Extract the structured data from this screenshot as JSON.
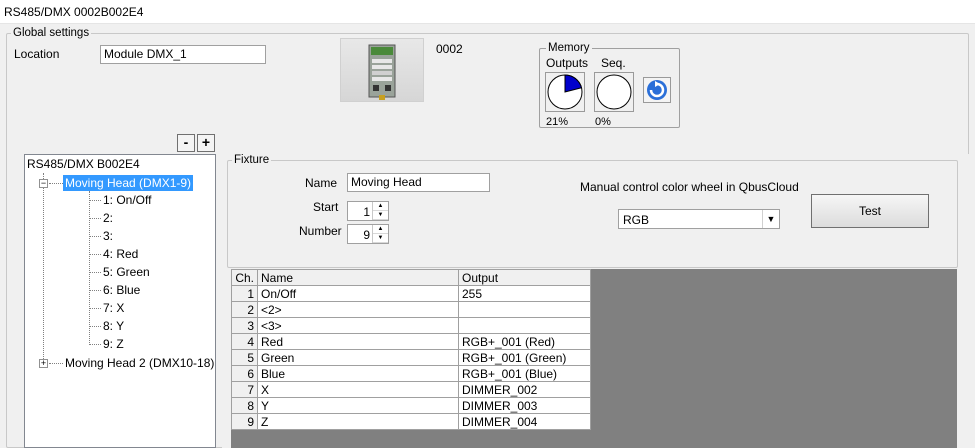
{
  "window": {
    "title": "RS485/DMX 0002B002E4"
  },
  "global_settings": {
    "label": "Global settings",
    "location_label": "Location",
    "location_value": "Module DMX_1",
    "device_id": "0002"
  },
  "memory": {
    "label": "Memory",
    "outputs_label": "Outputs",
    "seq_label": "Seq.",
    "outputs_pct": "21%",
    "seq_pct": "0%",
    "outputs_fraction": 0.21,
    "seq_fraction": 0.0,
    "pie_fill_color": "#0000cc"
  },
  "tree_buttons": {
    "collapse": "-",
    "expand": "+"
  },
  "tree": {
    "root": "RS485/DMX B002E4",
    "node1": {
      "label": "Moving Head (DMX1-9)",
      "children": [
        "1: On/Off",
        "2:",
        "3:",
        "4: Red",
        "5: Green",
        "6: Blue",
        "7: X",
        "8: Y",
        "9: Z"
      ]
    },
    "node2": {
      "label": "Moving Head 2 (DMX10-18)"
    }
  },
  "fixture": {
    "label": "Fixture",
    "name_label": "Name",
    "name_value": "Moving Head",
    "start_label": "Start",
    "start_value": "1",
    "number_label": "Number",
    "number_value": "9",
    "color_wheel_label": "Manual control color wheel in QbusCloud",
    "color_wheel_value": "RGB",
    "test_button": "Test"
  },
  "grid": {
    "headers": [
      "Ch.",
      "Name",
      "Output"
    ],
    "rows": [
      {
        "ch": "1",
        "name": "On/Off",
        "output": "255"
      },
      {
        "ch": "2",
        "name": "<2>",
        "output": ""
      },
      {
        "ch": "3",
        "name": "<3>",
        "output": ""
      },
      {
        "ch": "4",
        "name": "Red",
        "output": "RGB+_001 (Red)"
      },
      {
        "ch": "5",
        "name": "Green",
        "output": "RGB+_001 (Green)"
      },
      {
        "ch": "6",
        "name": "Blue",
        "output": "RGB+_001 (Blue)"
      },
      {
        "ch": "7",
        "name": "X",
        "output": "DIMMER_002"
      },
      {
        "ch": "8",
        "name": "Y",
        "output": "DIMMER_003"
      },
      {
        "ch": "9",
        "name": "Z",
        "output": "DIMMER_004"
      }
    ]
  },
  "colors": {
    "selection": "#3399ff",
    "grid_background": "#808080"
  }
}
